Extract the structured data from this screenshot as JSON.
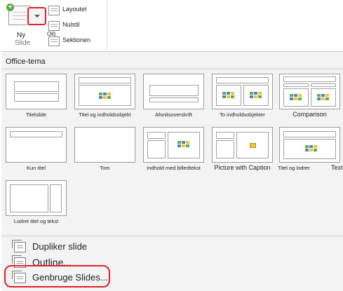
{
  "ribbon": {
    "new_slide_label": "Ny",
    "new_slide_label2": "Slide",
    "layout_label": "Layoutet",
    "reset_label": "Nulstil",
    "section_label": "Sektionen",
    "small_label": "Oil)"
  },
  "panel": {
    "title": "Office-tema",
    "layouts": [
      "Titelslide",
      "Titel og indholdsobjekt",
      "Afsnitsoverskrift",
      "To indholdsobjekter",
      "Comparison",
      "Kun titel",
      "Tom",
      "Indhold med billedtekst",
      "Picture with Caption",
      "Titel og lodret",
      "Text",
      "Lodret titel og tekst"
    ]
  },
  "menu": {
    "duplicate": "Dupliker slide",
    "outline": "Outline...",
    "reuse": "Genbruge Slides..."
  },
  "colors": {
    "highlight_red": "#e0212d",
    "placeholder_green": "#6aa84f",
    "placeholder_blue": "#4a86c5",
    "placeholder_yellow": "#f1c232"
  }
}
